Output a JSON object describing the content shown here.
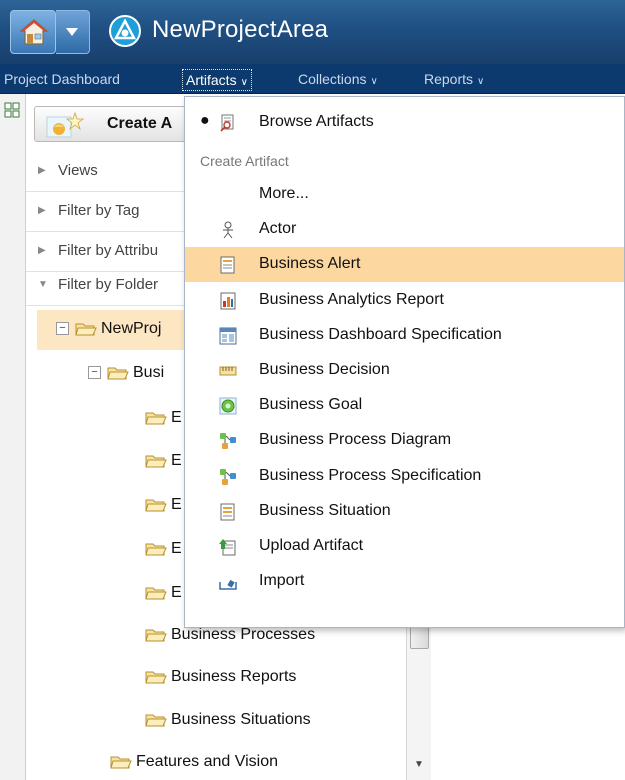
{
  "app": {
    "title": "NewProjectArea",
    "home_icon": "home-icon",
    "logo_icon": "app-logo-icon",
    "colors": {
      "titlebar": "#1f4f82",
      "navbar": "#0d3a6e",
      "highlight": "#fcd8a0",
      "tree_selected": "#fde6c2"
    }
  },
  "nav": {
    "items": [
      {
        "label": "Project Dashboard",
        "has_dropdown": false,
        "active": false
      },
      {
        "label": "Artifacts",
        "has_dropdown": true,
        "active": true
      },
      {
        "label": "Collections",
        "has_dropdown": true,
        "active": false
      },
      {
        "label": "Reports",
        "has_dropdown": true,
        "active": false
      }
    ]
  },
  "left_panel": {
    "create_button_label": "Create A",
    "filters": [
      {
        "label": "Views",
        "expanded": false
      },
      {
        "label": "Filter by Tag",
        "expanded": false
      },
      {
        "label": "Filter by Attribu",
        "expanded": false
      },
      {
        "label": "Filter by Folder",
        "expanded": true
      }
    ],
    "tree": [
      {
        "label": "NewProj",
        "expander": "−",
        "level": 0,
        "selected": true
      },
      {
        "label": "Busi",
        "expander": "−",
        "level": 1,
        "selected": false
      },
      {
        "label": "E",
        "level": 2
      },
      {
        "label": "E",
        "level": 2
      },
      {
        "label": "E",
        "level": 2
      },
      {
        "label": "E",
        "level": 2
      },
      {
        "label": "E",
        "level": 2
      },
      {
        "label": "Business Processes",
        "level": 2
      },
      {
        "label": "Business Reports",
        "level": 2
      },
      {
        "label": "Business Situations",
        "level": 2
      },
      {
        "label": "Features and Vision",
        "level": 1
      }
    ]
  },
  "menu": {
    "browse": {
      "label": "Browse Artifacts",
      "icon": "browse-artifacts-icon",
      "selected": true
    },
    "section_header": "Create Artifact",
    "items": [
      {
        "label": "More...",
        "icon": ""
      },
      {
        "label": "Actor",
        "icon": "actor-icon"
      },
      {
        "label": "Business Alert",
        "icon": "business-alert-icon",
        "highlighted": true
      },
      {
        "label": "Business Analytics Report",
        "icon": "analytics-report-icon"
      },
      {
        "label": "Business Dashboard Specification",
        "icon": "dashboard-spec-icon"
      },
      {
        "label": "Business Decision",
        "icon": "decision-icon"
      },
      {
        "label": "Business Goal",
        "icon": "goal-icon"
      },
      {
        "label": "Business Process Diagram",
        "icon": "process-diagram-icon"
      },
      {
        "label": "Business Process Specification",
        "icon": "process-spec-icon"
      },
      {
        "label": "Business Situation",
        "icon": "situation-icon"
      },
      {
        "label": "Upload Artifact",
        "icon": "upload-icon"
      },
      {
        "label": "Import",
        "icon": "import-icon"
      }
    ]
  }
}
